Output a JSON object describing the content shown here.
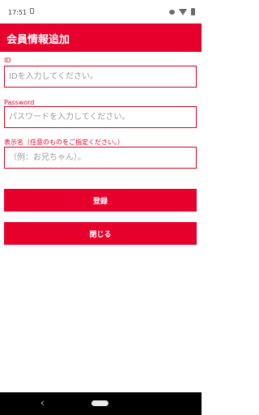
{
  "status_bar": {
    "time": "17:51",
    "icons": [
      "sim-card-icon",
      "eye-icon",
      "wifi-icon",
      "battery-icon"
    ]
  },
  "header": {
    "title": "会員情報追加"
  },
  "form": {
    "id": {
      "label": "ID",
      "placeholder": "IDを入力してください。",
      "value": ""
    },
    "password": {
      "label": "Password",
      "placeholder": "パスワードを入力してください。",
      "value": ""
    },
    "display_name": {
      "label": "表示名（任意のものをご指定ください。）",
      "placeholder": "（例：お兄ちゃん）。",
      "value": ""
    }
  },
  "buttons": {
    "register_label": "登録",
    "close_label": "閉じる"
  },
  "nav_bar": {
    "back_glyph": "‹"
  },
  "colors": {
    "accent": "#e8002d",
    "field_border": "#d8001c",
    "placeholder": "#9a9a9a"
  }
}
